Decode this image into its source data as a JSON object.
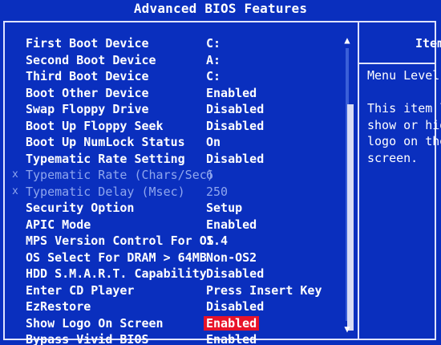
{
  "window": {
    "title": "Advanced BIOS Features"
  },
  "settings": [
    {
      "label": "First Boot Device",
      "value": "C:",
      "state": "normal"
    },
    {
      "label": "Second Boot Device",
      "value": "A:",
      "state": "normal"
    },
    {
      "label": "Third Boot Device",
      "value": "C:",
      "state": "normal"
    },
    {
      "label": "Boot Other Device",
      "value": "Enabled",
      "state": "normal"
    },
    {
      "label": "Swap Floppy Drive",
      "value": "Disabled",
      "state": "normal"
    },
    {
      "label": "Boot Up Floppy Seek",
      "value": "Disabled",
      "state": "normal"
    },
    {
      "label": "Boot Up NumLock Status",
      "value": "On",
      "state": "normal"
    },
    {
      "label": "Typematic Rate Setting",
      "value": "Disabled",
      "state": "normal"
    },
    {
      "label": "Typematic Rate (Chars/Sec)",
      "value": "6",
      "state": "disabled",
      "marker": "x"
    },
    {
      "label": "Typematic Delay (Msec)",
      "value": "250",
      "state": "disabled",
      "marker": "x"
    },
    {
      "label": "Security Option",
      "value": "Setup",
      "state": "normal"
    },
    {
      "label": "APIC Mode",
      "value": "Enabled",
      "state": "normal"
    },
    {
      "label": "MPS Version Control For OS",
      "value": "1.4",
      "state": "normal"
    },
    {
      "label": "OS Select For DRAM > 64MB",
      "value": "Non-OS2",
      "state": "normal"
    },
    {
      "label": "HDD S.M.A.R.T. Capability",
      "value": "Disabled",
      "state": "normal"
    },
    {
      "label": "Enter CD Player",
      "value": "Press Insert Key",
      "state": "normal"
    },
    {
      "label": "EzRestore",
      "value": "Disabled",
      "state": "normal"
    },
    {
      "label": "Show Logo On Screen",
      "value": "Enabled",
      "state": "selected"
    },
    {
      "label": "Bypass Vivid BIOS",
      "value": "Enabled",
      "state": "normal"
    }
  ],
  "help": {
    "header": "Item",
    "menu_level": "Menu Level",
    "description_lines": [
      "This item le",
      "show or hide",
      "logo on the",
      "screen."
    ]
  },
  "scrollbar": {
    "up_glyph": "▲",
    "down_glyph": "▼"
  },
  "colors": {
    "background": "#0a2fbe",
    "text": "#ffffff",
    "disabled_text": "#8fa6ee",
    "highlight": "#e8132a"
  }
}
